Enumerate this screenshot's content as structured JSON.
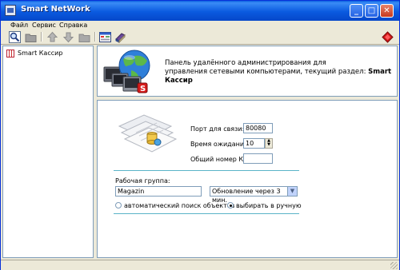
{
  "window": {
    "title": "Smart NetWork"
  },
  "menu": [
    "Файл",
    "Сервис",
    "Справка"
  ],
  "toolbar": {
    "icons": [
      "search-icon",
      "folder-icon",
      "arrow-up-icon",
      "arrow-down-icon",
      "folder-gray-icon",
      "window-icon",
      "books-icon",
      "exit-icon"
    ]
  },
  "tree": {
    "items": [
      {
        "label": "Smart Кассир",
        "icon": "grid-icon"
      }
    ]
  },
  "header": {
    "line1": "Панель удалённого администрирования для",
    "line2": "управления сетевыми компьютерами, текущий раздел:",
    "section": "Smart Кассир"
  },
  "settings": {
    "port_label": "Порт для связи:",
    "port_value": "80080",
    "timeout_label": "Время ожидания:",
    "timeout_value": "10",
    "kkm_label": "Общий номер ККМ:",
    "kkm_value": ""
  },
  "workgroup": {
    "label": "Рабочая группа:",
    "value": "Magazin",
    "refresh_selected": "Обновление через 3 мин.",
    "radio_auto": "автоматический поиск объектов",
    "radio_manual": "выбирать в ручную",
    "selected_radio": "manual"
  },
  "colors": {
    "titlebar": "#0a5ae0",
    "accent_line": "#5ab4c8",
    "window_bg": "#ece9d8"
  }
}
